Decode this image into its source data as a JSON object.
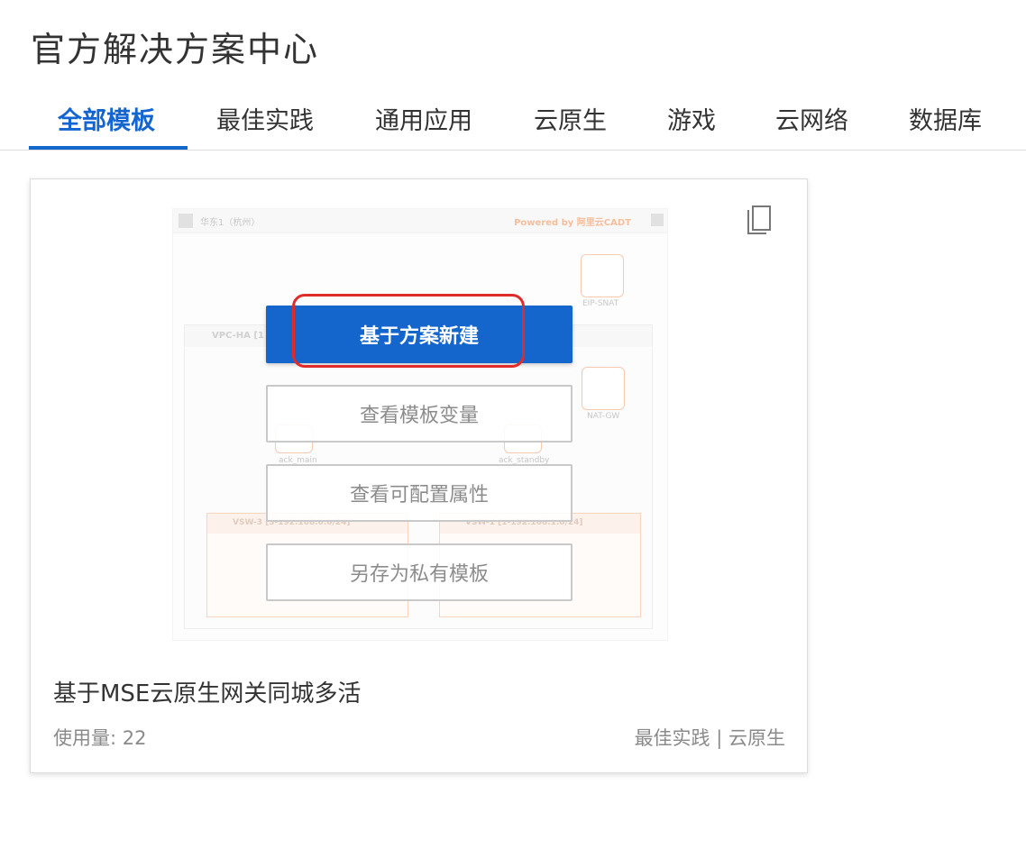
{
  "page": {
    "title": "官方解决方案中心"
  },
  "tabs": [
    {
      "label": "全部模板",
      "active": true
    },
    {
      "label": "最佳实践"
    },
    {
      "label": "通用应用"
    },
    {
      "label": "云原生"
    },
    {
      "label": "游戏"
    },
    {
      "label": "云网络"
    },
    {
      "label": "数据库"
    }
  ],
  "card": {
    "title": "基于MSE云原生网关同城多活",
    "usage": "使用量: 22",
    "tags": "最佳实践 | 云原生",
    "copy_icon": "copy-icon",
    "actions": {
      "create": "基于方案新建",
      "view_variables": "查看模板变量",
      "view_properties": "查看可配置属性",
      "save_private": "另存为私有模板"
    },
    "diagram": {
      "region": "华东1（杭州）",
      "powered": "Powered by 阿里云CADT",
      "vpc": "VPC-HA [1",
      "vsw_left": "VSW-3 [3-192.168.0.0/24]",
      "vsw_right": "VSW-1 [1-192.168.1.0/24]",
      "eip": "EIP-SNAT",
      "nat": "NAT-GW",
      "ack_main": "ack_main",
      "ack_standby": "ack_standby"
    }
  },
  "colors": {
    "accent": "#1466cc",
    "highlight": "#e02b2b",
    "diagram_accent": "#f08a4b"
  }
}
